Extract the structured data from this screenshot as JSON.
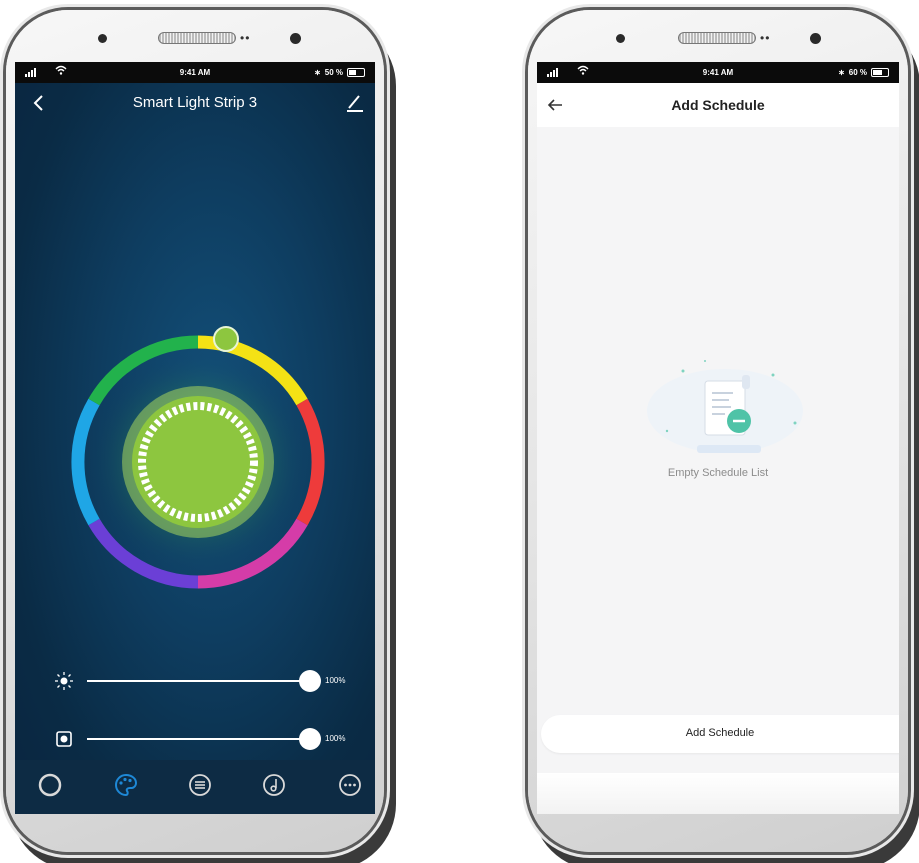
{
  "left_phone": {
    "status": {
      "time": "9:41 AM",
      "battery": "50 %",
      "battery_fraction": 0.5
    },
    "header": {
      "title": "Smart Light Strip 3",
      "back_icon": "chevron-left-icon",
      "edit_icon": "pencil-icon"
    },
    "color_wheel": {
      "selected_color": "#8dc63f"
    },
    "brightness": {
      "icon": "sun-icon",
      "value_label": "100%",
      "fraction": 1.0
    },
    "saturation": {
      "icon": "contrast-icon",
      "value_label": "100%",
      "fraction": 1.0
    },
    "tabs": [
      {
        "icon": "circle-icon",
        "active": false
      },
      {
        "icon": "palette-icon",
        "active": true
      },
      {
        "icon": "list-icon",
        "active": false
      },
      {
        "icon": "music-icon",
        "active": false
      },
      {
        "icon": "more-icon",
        "active": false
      }
    ],
    "colors": {
      "active_tab": "#1e88d6",
      "inactive_tab": "#d9d9d9"
    }
  },
  "right_phone": {
    "status": {
      "time": "9:41 AM",
      "battery": "60 %",
      "battery_fraction": 0.6
    },
    "header": {
      "title": "Add Schedule",
      "back_icon": "arrow-left-icon"
    },
    "empty": {
      "text": "Empty Schedule List",
      "icon": "empty-document-icon"
    },
    "add_button": {
      "label": "Add Schedule"
    },
    "colors": {
      "accent": "#4fc3a7"
    }
  }
}
